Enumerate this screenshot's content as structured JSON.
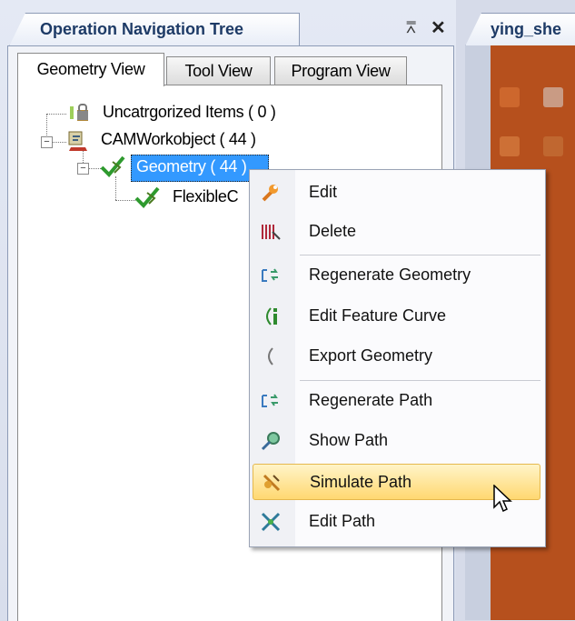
{
  "panel": {
    "title": "Operation Navigation Tree",
    "pin_glyph": "⩞",
    "close_glyph": "✕"
  },
  "tabs": [
    {
      "label": "Geometry View",
      "active": true
    },
    {
      "label": "Tool View",
      "active": false
    },
    {
      "label": "Program View",
      "active": false
    }
  ],
  "tree": {
    "items": [
      {
        "label": "Uncatrgorized Items ( 0 )",
        "icon": "lock-folder-icon"
      },
      {
        "label": "CAMWorkobject ( 44 )",
        "icon": "workobject-icon",
        "expanded": true
      },
      {
        "label": "Geometry ( 44 )",
        "icon": "geometry-check-icon",
        "expanded": true,
        "selected": true
      },
      {
        "label": "FlexibleC",
        "icon": "geometry-check-icon"
      }
    ]
  },
  "right_panel": {
    "tab_title": "ying_she"
  },
  "context_menu": {
    "items": [
      {
        "label": "Edit",
        "icon": "wrench-icon"
      },
      {
        "label": "Delete",
        "icon": "delete-icon"
      },
      {
        "label": "Regenerate Geometry",
        "icon": "regenerate-geometry-icon"
      },
      {
        "label": "Edit Feature Curve",
        "icon": "edit-feature-curve-icon"
      },
      {
        "label": "Export Geometry",
        "icon": "export-geometry-icon"
      },
      {
        "label": "Regenerate Path",
        "icon": "regenerate-path-icon"
      },
      {
        "label": "Show Path",
        "icon": "show-path-icon"
      },
      {
        "label": "Simulate Path",
        "icon": "simulate-path-icon",
        "highlighted": true
      },
      {
        "label": "Edit Path",
        "icon": "edit-path-icon"
      }
    ]
  },
  "colors": {
    "selection": "#3399ff",
    "menu_highlight": "#ffd871",
    "viewport": "#b6501d",
    "title_text": "#1d3a66"
  }
}
